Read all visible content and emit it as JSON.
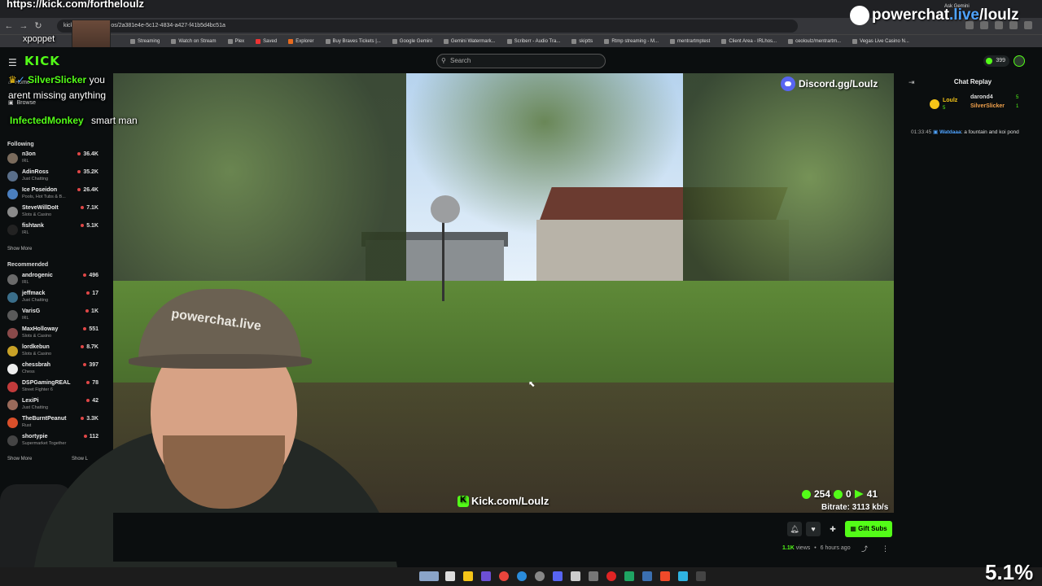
{
  "overlay_url": "https://kick.com/fortheloulz",
  "browser": {
    "url": "kick.com/loulz/videos/2a381e4e-5c12-4834-a427-f41b5d4bc51a",
    "ask_gemini": "Ask Gemini",
    "bookmarks": [
      "Streaming",
      "Watch on Stream",
      "Plex",
      "Saved",
      "Explorer",
      "Buy Braves Tickets |...",
      "Google Gemini",
      "Gemini Watermark...",
      "Scriberr - Audio Tra...",
      "skiptts",
      "Rtmp streaming - M...",
      "mentrartmptest",
      "Client Area - IRLhos...",
      "ceoloulz/mentrartm...",
      "Vegas Live Casino N..."
    ]
  },
  "kick": {
    "logo": "KICK",
    "search_placeholder": "Search",
    "points": "399"
  },
  "chat_overlay": [
    {
      "user": "SilverSlicker",
      "text": "you"
    },
    {
      "user": "",
      "text": "arent  missing  anything"
    },
    {
      "user": "InfectedMonkey",
      "text": "smart  man"
    }
  ],
  "overlay_misc": {
    "xpoppet": "xpoppet"
  },
  "sidebar": {
    "home": "Home",
    "browse": "Browse",
    "following_title": "Following",
    "following": [
      {
        "name": "n3on",
        "cat": "IRL",
        "viewers": "36.4K",
        "color": "#7a6b5c"
      },
      {
        "name": "AdinRoss",
        "cat": "Just Chatting",
        "viewers": "35.2K",
        "color": "#5a6f8a"
      },
      {
        "name": "Ice Poseidon",
        "cat": "Pools, Hot Tubs & B...",
        "viewers": "26.4K",
        "color": "#4a7fbf"
      },
      {
        "name": "SteveWillDoIt",
        "cat": "Slots & Casino",
        "viewers": "7.1K",
        "color": "#8a8a8a"
      },
      {
        "name": "fishtank",
        "cat": "IRL",
        "viewers": "5.1K",
        "color": "#222"
      }
    ],
    "show_more": "Show More",
    "recommended_title": "Recommended",
    "recommended": [
      {
        "name": "androgenic",
        "cat": "IRL",
        "viewers": "496",
        "color": "#6a6a6a"
      },
      {
        "name": "jeffmack",
        "cat": "Just Chatting",
        "viewers": "17",
        "color": "#3a6e8a"
      },
      {
        "name": "VarisG",
        "cat": "IRL",
        "viewers": "1K",
        "color": "#5a5a5a"
      },
      {
        "name": "MaxHolloway",
        "cat": "Slots & Casino",
        "viewers": "551",
        "color": "#8a4a4a"
      },
      {
        "name": "lordkebun",
        "cat": "Slots & Casino",
        "viewers": "8.7K",
        "color": "#c9a227"
      },
      {
        "name": "chessbrah",
        "cat": "Chess",
        "viewers": "397",
        "color": "#eee"
      },
      {
        "name": "DSPGamingREAL",
        "cat": "Street Fighter 6",
        "viewers": "78",
        "color": "#c23b3b"
      },
      {
        "name": "LexiPi",
        "cat": "Just Chatting",
        "viewers": "42",
        "color": "#9a6a5a"
      },
      {
        "name": "TheBurntPeanut",
        "cat": "Rust",
        "viewers": "3.3K",
        "color": "#d94f2a"
      },
      {
        "name": "shortypie",
        "cat": "Supermarket Together",
        "viewers": "112",
        "color": "#444"
      }
    ],
    "show_more_2": "Show More",
    "show_less": "Show L"
  },
  "video": {
    "discord": "Discord.gg/Loulz",
    "watermark": "Kick.com/Loulz",
    "stat1": "254",
    "stat2": "0",
    "stat3": "41",
    "bitrate": "Bitrate: 3113 kb/s",
    "cap_text": "powerchat.live"
  },
  "chat_panel": {
    "title": "Chat Replay",
    "leaderboard": [
      {
        "name": "Loulz",
        "num": "5"
      },
      {
        "name": "darond4",
        "num": "5"
      },
      {
        "name": "SilverSlicker",
        "num": "1"
      }
    ],
    "message": {
      "time": "01:33:45",
      "user": "Watdaaa",
      "text": ": a fountain and koi pond"
    }
  },
  "below_video": {
    "gift_subs": "Gift Subs",
    "views": "1.1K",
    "views_label": "views",
    "ago": "6 hours ago"
  },
  "powerchat": {
    "brand": "powerchat",
    "live": ".live",
    "handle": "/loulz"
  },
  "taskbar": {
    "cpu": "5.1%"
  },
  "colors": {
    "kick_green": "#53fc18",
    "background": "#0b0e0f",
    "link_blue": "#4fa3ff"
  }
}
